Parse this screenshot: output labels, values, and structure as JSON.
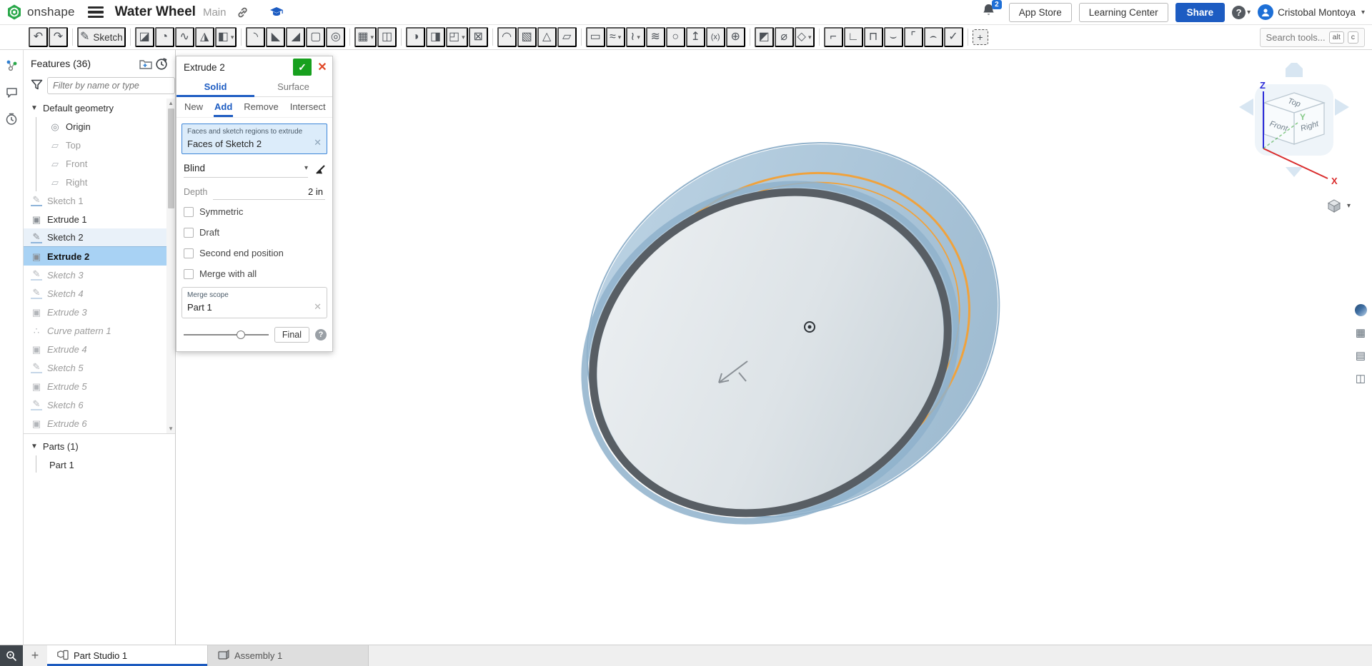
{
  "header": {
    "logo_text": "onshape",
    "title": "Water Wheel",
    "branch": "Main",
    "notification_count": "2",
    "app_store_label": "App Store",
    "learning_center_label": "Learning Center",
    "share_label": "Share",
    "user_name": "Cristobal Montoya"
  },
  "toolbar": {
    "search_placeholder": "Search tools...",
    "kbd_alt": "alt",
    "kbd_c": "c",
    "items": [
      {
        "name": "undo",
        "glyph": "↶"
      },
      {
        "name": "redo",
        "glyph": "↷"
      },
      {
        "divider": true
      },
      {
        "name": "sketch",
        "glyph": "✎",
        "label": "Sketch"
      },
      {
        "divider": true
      },
      {
        "name": "extrude",
        "glyph": "◪"
      },
      {
        "name": "revolve",
        "glyph": "◔"
      },
      {
        "name": "sweep",
        "glyph": "∿"
      },
      {
        "name": "loft",
        "glyph": "◮"
      },
      {
        "name": "thicken",
        "glyph": "◧",
        "caret": true
      },
      {
        "divider": true
      },
      {
        "name": "fillet",
        "glyph": "◝"
      },
      {
        "name": "chamfer",
        "glyph": "◣"
      },
      {
        "name": "draft",
        "glyph": "◢"
      },
      {
        "name": "shell",
        "glyph": "▢"
      },
      {
        "name": "hole",
        "glyph": "◎"
      },
      {
        "divider": true
      },
      {
        "name": "linear-pattern",
        "glyph": "▦",
        "caret": true
      },
      {
        "name": "mirror",
        "glyph": "◫"
      },
      {
        "divider": true
      },
      {
        "name": "boolean",
        "glyph": "◑"
      },
      {
        "name": "split",
        "glyph": "◨"
      },
      {
        "name": "transform",
        "glyph": "◰",
        "caret": true
      },
      {
        "name": "delete-part",
        "glyph": "⊠"
      },
      {
        "divider": true
      },
      {
        "name": "modify-fillet",
        "glyph": "◠"
      },
      {
        "name": "delete-face",
        "glyph": "▧"
      },
      {
        "name": "move-face",
        "glyph": "△"
      },
      {
        "name": "offset-surface",
        "glyph": "▱"
      },
      {
        "divider": true
      },
      {
        "name": "plane",
        "glyph": "▭"
      },
      {
        "name": "curve",
        "glyph": "≈",
        "caret": true
      },
      {
        "name": "composite-curve",
        "glyph": "≀",
        "caret": true
      },
      {
        "name": "helix",
        "glyph": "≋"
      },
      {
        "name": "circle-tool",
        "glyph": "○"
      },
      {
        "name": "import",
        "glyph": "↥"
      },
      {
        "name": "variable",
        "glyph": "(x)"
      },
      {
        "name": "mate-connector",
        "glyph": "⊕"
      },
      {
        "divider": true
      },
      {
        "name": "split-part",
        "glyph": "◩"
      },
      {
        "name": "measure",
        "glyph": "⌀"
      },
      {
        "name": "named-views",
        "glyph": "◇",
        "caret": true
      },
      {
        "divider": true
      },
      {
        "name": "sheet-metal-model",
        "glyph": "⌐"
      },
      {
        "name": "flange",
        "glyph": "∟"
      },
      {
        "name": "tab",
        "glyph": "⊓"
      },
      {
        "name": "bend",
        "glyph": "⌣"
      },
      {
        "name": "corner",
        "glyph": "⌜"
      },
      {
        "name": "hem",
        "glyph": "⌢"
      },
      {
        "name": "sheet-metal-finish",
        "glyph": "✓"
      },
      {
        "divider": true
      },
      {
        "name": "select-region",
        "glyph": "+",
        "frame": true
      }
    ]
  },
  "left_rail": {
    "items": [
      "follow-mode",
      "comments",
      "history"
    ]
  },
  "features_panel": {
    "title": "Features (36)",
    "filter_placeholder": "Filter by name or type",
    "tree": [
      {
        "label": "Default geometry",
        "icon": "group",
        "state": "normal",
        "group": true
      },
      {
        "label": "Origin",
        "icon": "origin",
        "state": "normal",
        "indent": true
      },
      {
        "label": "Top",
        "icon": "plane",
        "state": "muted",
        "indent": true
      },
      {
        "label": "Front",
        "icon": "plane",
        "state": "muted",
        "indent": true
      },
      {
        "label": "Right",
        "icon": "plane",
        "state": "muted",
        "indent": true
      },
      {
        "label": "Sketch 1",
        "icon": "sketch",
        "state": "muted"
      },
      {
        "label": "Extrude 1",
        "icon": "extrude",
        "state": "normal"
      },
      {
        "label": "Sketch 2",
        "icon": "sketch",
        "state": "highlight"
      },
      {
        "label": "Extrude 2",
        "icon": "extrude",
        "state": "selected"
      },
      {
        "label": "Sketch 3",
        "icon": "sketch",
        "state": "rolled"
      },
      {
        "label": "Sketch 4",
        "icon": "sketch",
        "state": "rolled"
      },
      {
        "label": "Extrude 3",
        "icon": "extrude",
        "state": "rolled"
      },
      {
        "label": "Curve pattern 1",
        "icon": "curve-pattern",
        "state": "rolled"
      },
      {
        "label": "Extrude 4",
        "icon": "extrude",
        "state": "rolled"
      },
      {
        "label": "Sketch 5",
        "icon": "sketch",
        "state": "rolled"
      },
      {
        "label": "Extrude 5",
        "icon": "extrude",
        "state": "rolled"
      },
      {
        "label": "Sketch 6",
        "icon": "sketch",
        "state": "rolled"
      },
      {
        "label": "Extrude 6",
        "icon": "extrude",
        "state": "rolled"
      }
    ],
    "parts_title": "Parts (1)",
    "parts": [
      "Part 1"
    ]
  },
  "dialog": {
    "title": "Extrude 2",
    "tabs": [
      "Solid",
      "Surface"
    ],
    "active_tab": "Solid",
    "modes": [
      "New",
      "Add",
      "Remove",
      "Intersect"
    ],
    "active_mode": "Add",
    "selection_label": "Faces and sketch regions to extrude",
    "selection_value": "Faces of Sketch 2",
    "end_condition": "Blind",
    "depth_label": "Depth",
    "depth_value": "2 in",
    "checkboxes": [
      "Symmetric",
      "Draft",
      "Second end position",
      "Merge with all"
    ],
    "merge_scope_label": "Merge scope",
    "merge_scope_value": "Part 1",
    "final_label": "Final",
    "slider_percent": 62
  },
  "viewport": {
    "view_cube": {
      "top": "Top",
      "front": "Front",
      "right": "Right",
      "x": "X",
      "y": "Y",
      "z": "Z"
    }
  },
  "footer": {
    "tabs": [
      {
        "label": "Part Studio 1",
        "type": "part-studio",
        "active": true
      },
      {
        "label": "Assembly 1",
        "type": "assembly",
        "active": false
      }
    ]
  }
}
